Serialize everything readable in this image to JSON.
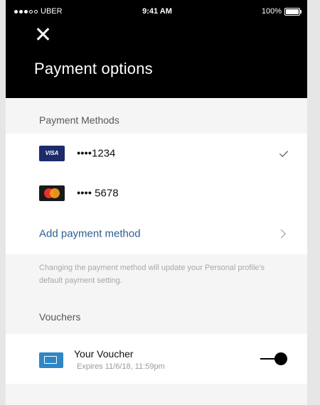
{
  "status_bar": {
    "carrier": "UBER",
    "time": "9:41 AM",
    "battery": "100%"
  },
  "header": {
    "close_icon": "close-icon",
    "title": "Payment options"
  },
  "payment_methods": {
    "header": "Payment Methods",
    "cards": [
      {
        "brand": "VISA",
        "number": "••••1234",
        "selected": true
      },
      {
        "brand": "mastercard",
        "number": "•••• 5678",
        "selected": false
      }
    ],
    "add_label": "Add payment method",
    "note": "Changing the payment method will update your Personal profile's default payment setting."
  },
  "vouchers": {
    "header": "Vouchers",
    "items": [
      {
        "title": "Your Voucher",
        "expiry": "Expires 11/6/18, 11:59pm",
        "enabled": true
      }
    ]
  },
  "colors": {
    "header_bg": "#000000",
    "link": "#2c5f8f",
    "voucher_icon": "#2f86c5",
    "visa": "#1d2a6b"
  }
}
